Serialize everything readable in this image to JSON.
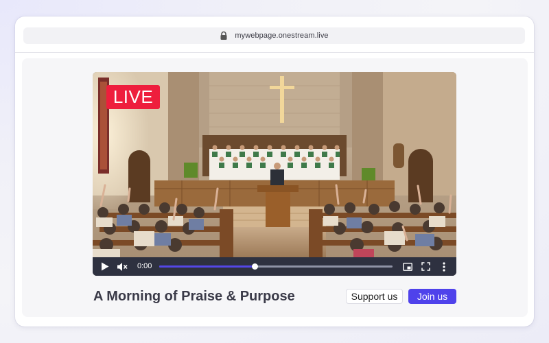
{
  "address_bar": {
    "url": "mywebpage.onestream.live",
    "icon": "lock-icon"
  },
  "video": {
    "live_label": "LIVE",
    "poster_alt": "Church service with choir, pastor at pulpit and congregation raising hands",
    "time": "0:00",
    "progress": 0.41,
    "icons": [
      "play-icon",
      "mute-icon",
      "pip-icon",
      "fullscreen-icon",
      "more-vertical-icon"
    ]
  },
  "event": {
    "title": "A Morning of Praise & Purpose"
  },
  "actions": {
    "support_label": "Support us",
    "join_label": "Join us"
  },
  "colors": {
    "live": "#ee1e3d",
    "accent": "#4f42eb",
    "controls_bg": "#2e3140"
  }
}
